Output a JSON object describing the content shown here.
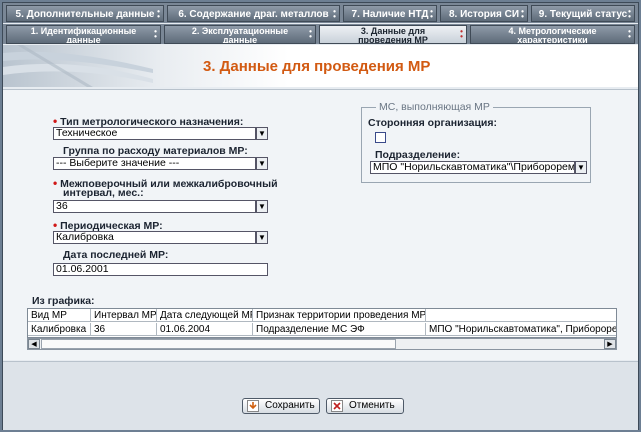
{
  "tabs_row1": [
    {
      "label": "5. Дополнительные данные"
    },
    {
      "label": "6. Содержание драг. металлов"
    },
    {
      "label": "7. Наличие НТД"
    },
    {
      "label": "8. История СИ"
    },
    {
      "label": "9. Текущий статус"
    }
  ],
  "tabs_row2": [
    {
      "line1": "1. Идентификационные",
      "line2": "данные"
    },
    {
      "line1": "2. Эксплуатационные",
      "line2": "данные"
    },
    {
      "line1": "3. Данные для",
      "line2": "проведения МР",
      "active": true
    },
    {
      "line1": "4. Метрологические",
      "line2": "характеристики"
    }
  ],
  "page_title": "3. Данные для проведения МР",
  "form": {
    "metro_type": {
      "label": "Тип метрологического назначения:",
      "value": "Техническое",
      "required": true
    },
    "material_group": {
      "label": "Группа по расходу материалов МР:",
      "value": "--- Выберите значение ---"
    },
    "interval": {
      "label_line1": "Межповерочный или межкалибровочный",
      "label_line2": "интервал, мес.:",
      "value": "36",
      "required": true
    },
    "periodic_mr": {
      "label": "Периодическая МР:",
      "value": "Калибровка",
      "required": true
    },
    "last_mr_date": {
      "label": "Дата последней МР:",
      "value": "01.06.2001"
    }
  },
  "ms_group": {
    "legend": "МС, выполняющая МР",
    "third_party_label": "Сторонняя организация:",
    "third_party_checked": false,
    "division_label": "Подразделение:",
    "division_value": "МПО \"Норильскавтоматика\"\\Приборорем"
  },
  "schedule": {
    "label": "Из графика:",
    "columns": [
      "Вид МР",
      "Интервал МР",
      "Дата следующей МР",
      "Признак территории проведения МР",
      ""
    ],
    "rows": [
      [
        "Калибровка",
        "36",
        "01.06.2004",
        "Подразделение МС ЭФ",
        "МПО \"Норильскавтоматика\", Приборорем"
      ]
    ]
  },
  "buttons": {
    "save": "Сохранить",
    "cancel": "Отменить"
  },
  "colors": {
    "title": "#d25a12",
    "required": "#d01818",
    "tab_bg": "#6e7b89",
    "active_tab_bg": "#dfe5eb"
  }
}
